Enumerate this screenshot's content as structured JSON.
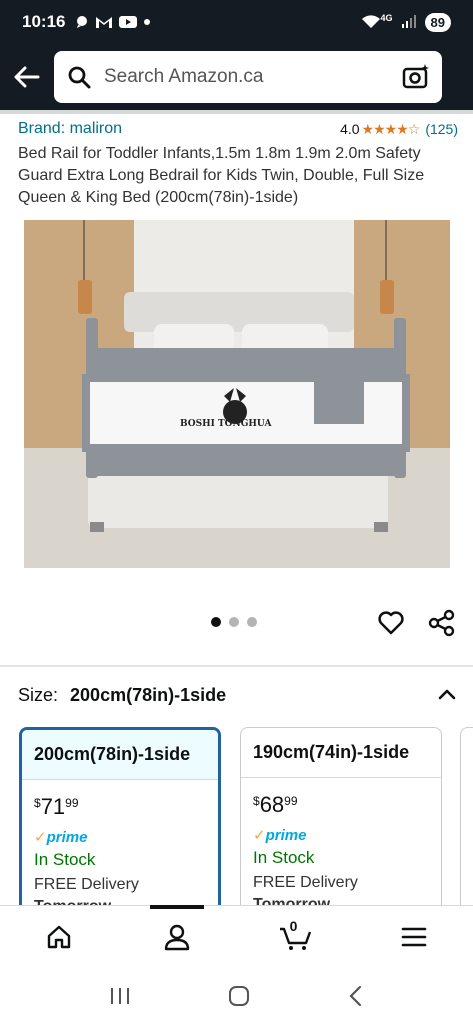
{
  "status_bar": {
    "time": "10:16",
    "battery": "89",
    "network": "4G"
  },
  "search": {
    "placeholder": "Search Amazon.ca"
  },
  "product": {
    "brand": "Brand: maliron",
    "rating_value": "4.0",
    "stars": "★★★★☆",
    "rating_count": "(125)",
    "title": "Bed Rail for Toddler Infants,1.5m 1.8m 1.9m 2.0m Safety Guard Extra Long Bedrail for Kids Twin, Double, Full Size Queen & King Bed (200cm(78in)-1side)",
    "image_brand_text": "BOSHI TONGHUA"
  },
  "carousel": {
    "count": 3,
    "active": 0
  },
  "size": {
    "label": "Size:",
    "value": "200cm(78in)-1side"
  },
  "options": [
    {
      "name": "200cm(78in)-1side",
      "currency": "$",
      "whole": "71",
      "cents": "99",
      "prime": "prime",
      "stock": "In Stock",
      "delivery": "FREE Delivery",
      "arrival": "Tomorrow",
      "selected": true
    },
    {
      "name": "190cm(74in)-1side",
      "currency": "$",
      "whole": "68",
      "cents": "99",
      "prime": "prime",
      "stock": "In Stock",
      "delivery": "FREE Delivery",
      "arrival": "Tomorrow",
      "selected": false
    }
  ],
  "nav": {
    "cart_count": "0"
  },
  "colors": {
    "header": "#151b22",
    "link": "#007185",
    "star": "#de7921",
    "stock": "#007600",
    "prime": "#00a8e1",
    "selected_border": "#2162a1"
  }
}
